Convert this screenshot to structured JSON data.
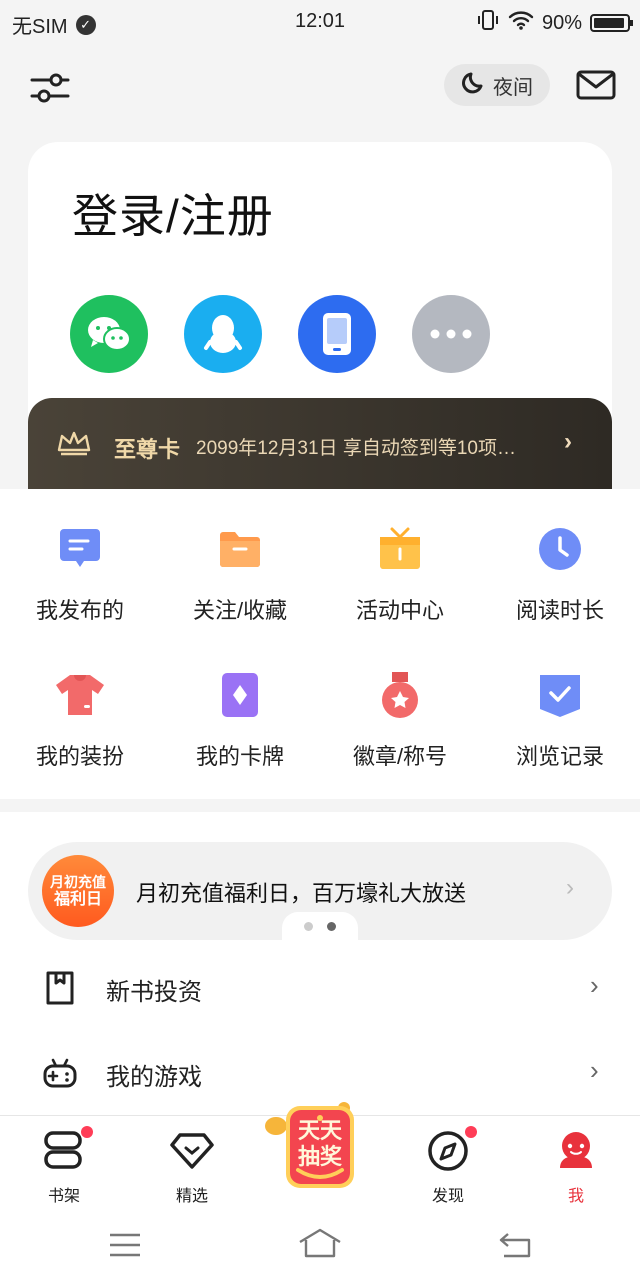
{
  "status": {
    "carrier": "无SIM",
    "time": "12:01",
    "battery": "90%"
  },
  "top": {
    "night_label": "夜间"
  },
  "login": {
    "title": "登录/注册",
    "options": [
      {
        "name": "wechat",
        "icon": "wechat-icon",
        "color": "#1fc05f"
      },
      {
        "name": "qq",
        "icon": "qq-penguin-icon",
        "color": "#1aaef0"
      },
      {
        "name": "phone",
        "icon": "phone-icon",
        "color": "#2d6cf0"
      },
      {
        "name": "more",
        "icon": "more-dots-icon",
        "color": "#b4b8c0"
      }
    ]
  },
  "vip": {
    "name": "至尊卡",
    "desc": "2099年12月31日  享自动签到等10项…"
  },
  "grid": [
    {
      "label": "我发布的",
      "icon": "message-icon"
    },
    {
      "label": "关注/收藏",
      "icon": "folder-icon"
    },
    {
      "label": "活动中心",
      "icon": "gift-icon"
    },
    {
      "label": "阅读时长",
      "icon": "clock-icon"
    },
    {
      "label": "我的装扮",
      "icon": "tshirt-icon"
    },
    {
      "label": "我的卡牌",
      "icon": "card-icon"
    },
    {
      "label": "徽章/称号",
      "icon": "medal-icon"
    },
    {
      "label": "浏览记录",
      "icon": "history-icon"
    }
  ],
  "banner": {
    "badge_line1": "月初充值",
    "badge_line2": "福利日",
    "text": "月初充值福利日，百万壕礼大放送"
  },
  "menu": [
    {
      "label": "新书投资",
      "icon": "bookmark-icon"
    },
    {
      "label": "我的游戏",
      "icon": "gamepad-icon"
    }
  ],
  "tabs": [
    {
      "label": "书架",
      "icon": "bookshelf-icon",
      "badge": true
    },
    {
      "label": "精选",
      "icon": "diamond-icon",
      "badge": false
    },
    {
      "label": "天天抽奖",
      "icon": "lottery-icon",
      "badge": false
    },
    {
      "label": "发现",
      "icon": "compass-icon",
      "badge": true
    },
    {
      "label": "我",
      "icon": "profile-icon",
      "badge": false
    }
  ],
  "colors": {
    "accent": "#e8323c",
    "vip_gold": "#f0d8a8"
  }
}
